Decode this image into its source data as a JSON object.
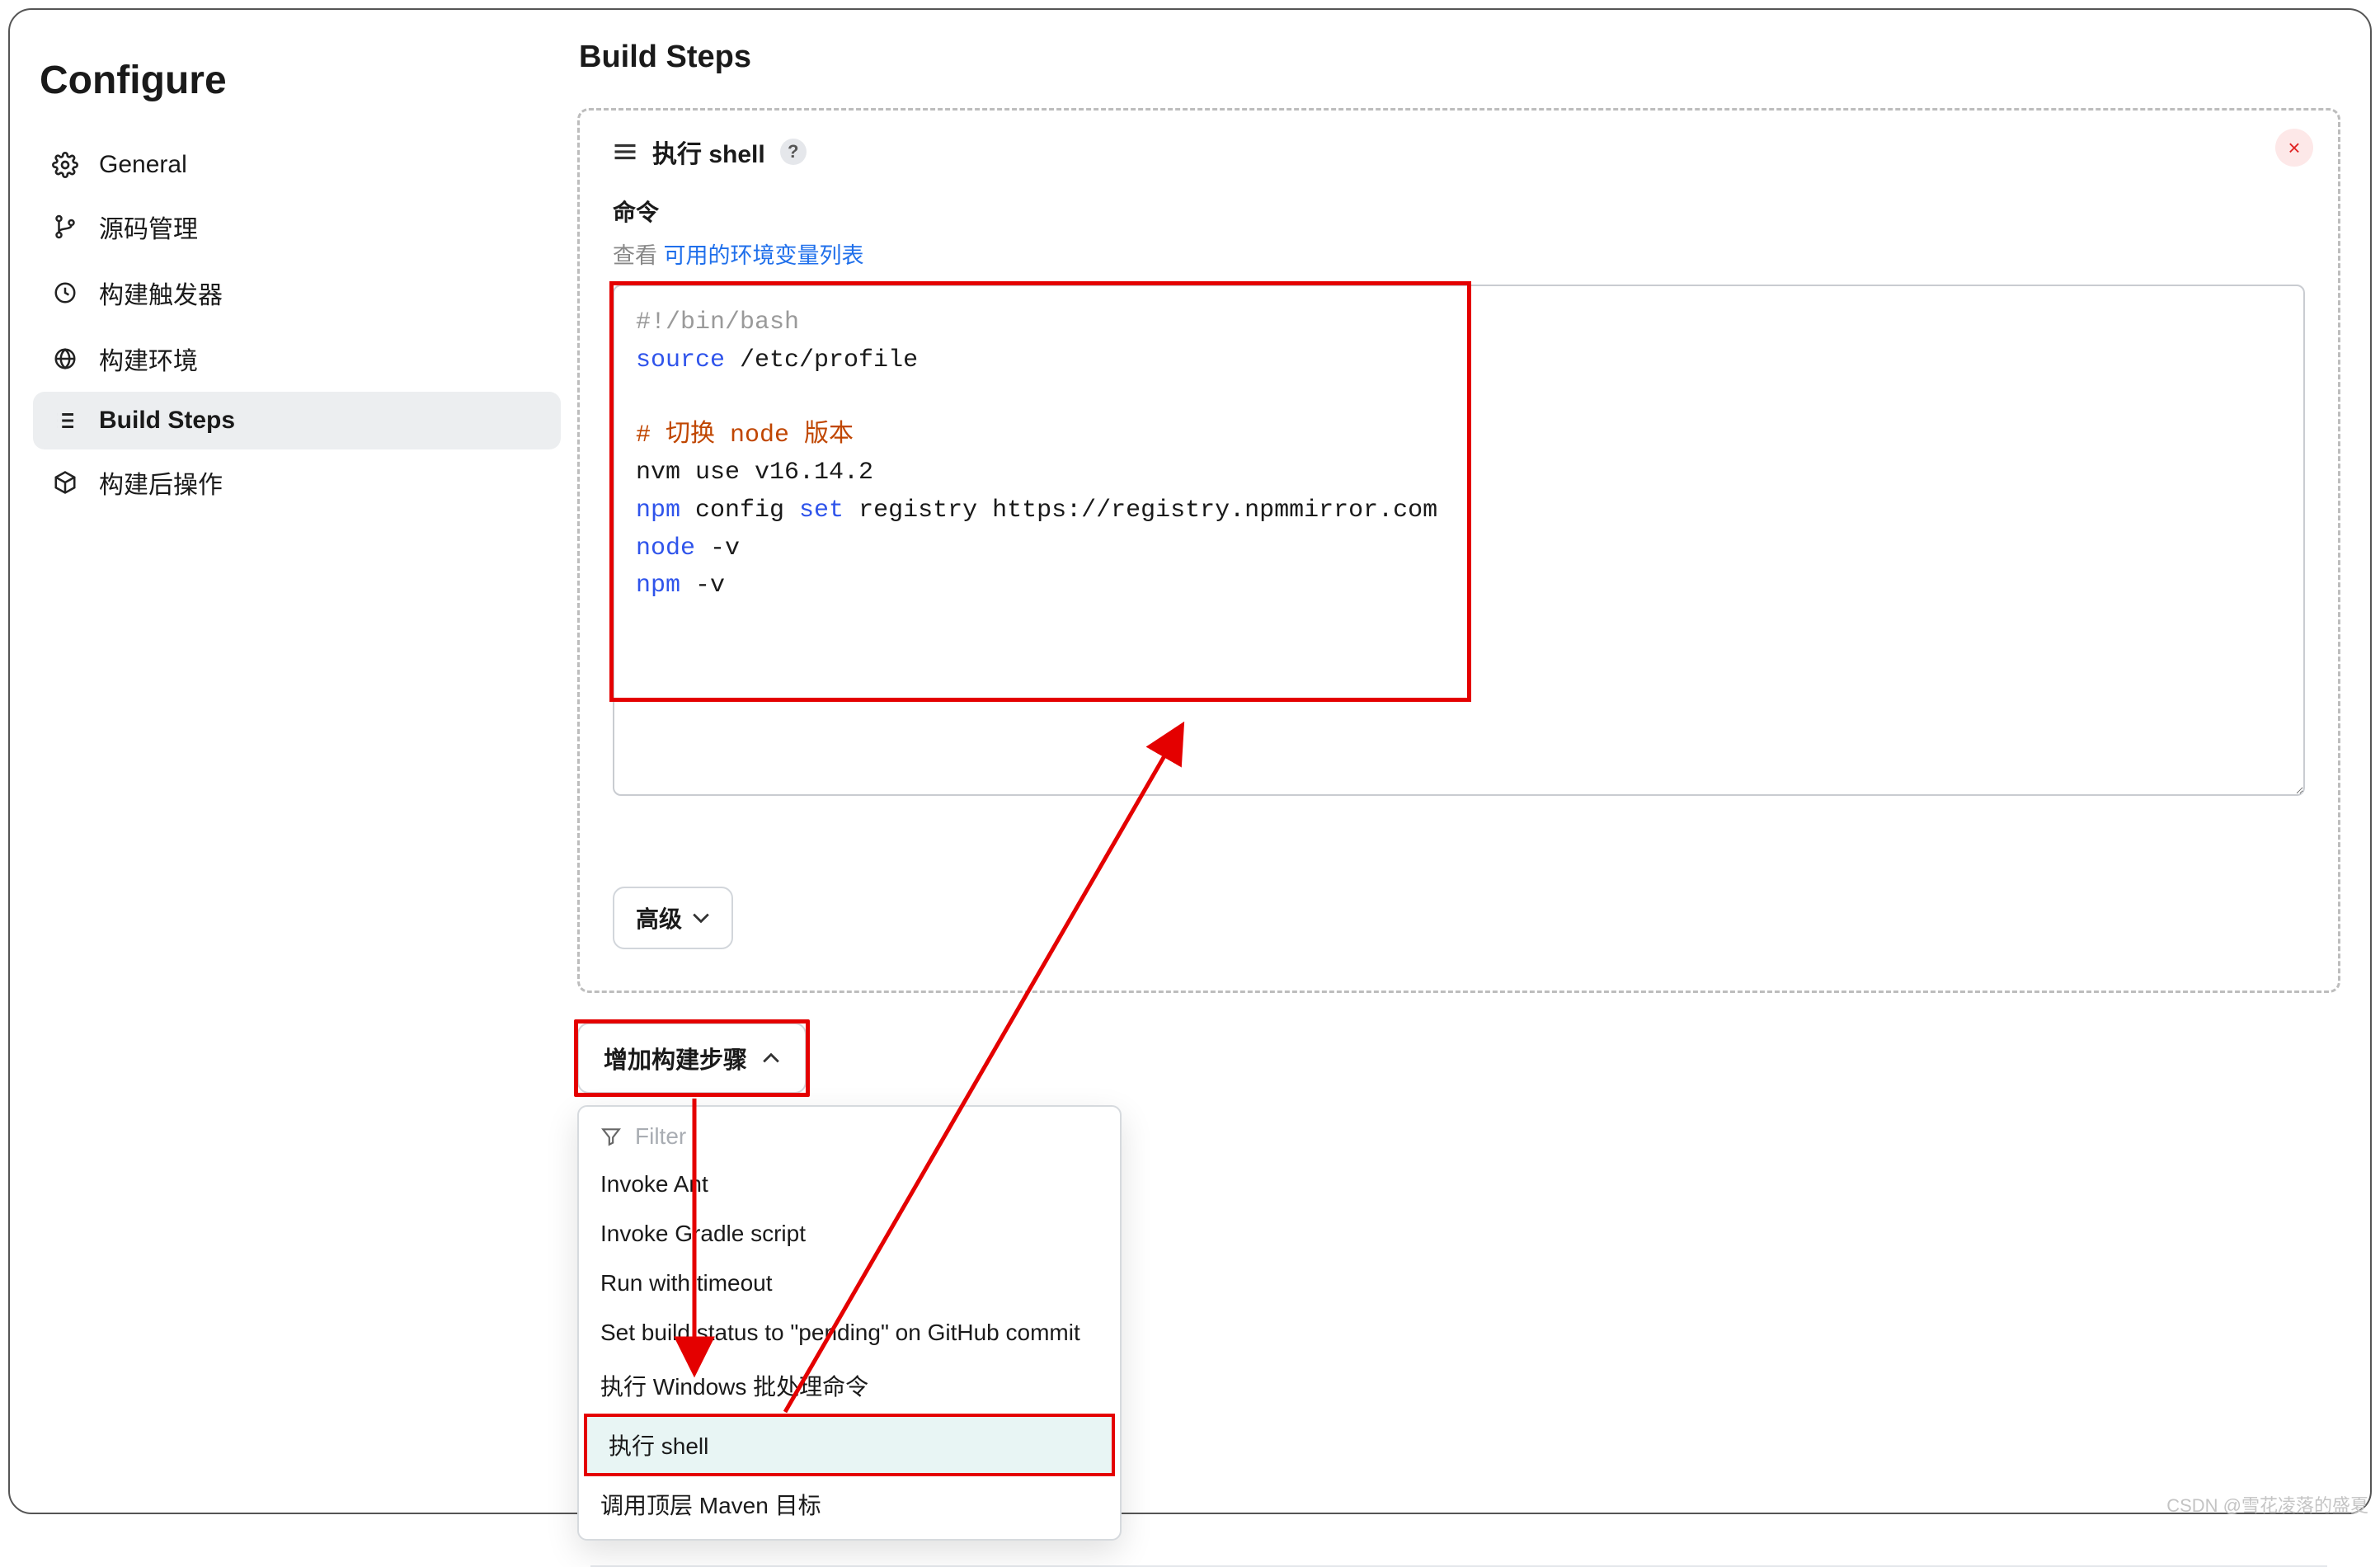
{
  "sidebar": {
    "title": "Configure",
    "items": [
      {
        "label": "General"
      },
      {
        "label": "源码管理"
      },
      {
        "label": "构建触发器"
      },
      {
        "label": "构建环境"
      },
      {
        "label": "Build Steps"
      },
      {
        "label": "构建后操作"
      }
    ]
  },
  "main": {
    "title": "Build Steps"
  },
  "step": {
    "title": "执行 shell",
    "help": "?",
    "close": "×",
    "command_label": "命令",
    "hint_prefix": "查看 ",
    "hint_link": "可用的环境变量列表",
    "code": {
      "line1_shebang": "#!/bin/bash",
      "line2_kw": "source",
      "line2_rest": " /etc/profile",
      "line3_cmt": "# 切换 node 版本",
      "line4": "nvm use v16.14.2",
      "line5_a": "npm",
      "line5_b": " config ",
      "line5_kw": "set",
      "line5_c": " registry https://registry.npmmirror.com",
      "line6_a": "node",
      "line6_b": " -v",
      "line7_a": "npm",
      "line7_b": " -v"
    },
    "advanced": "高级"
  },
  "add": {
    "button": "增加构建步骤",
    "filter_placeholder": "Filter",
    "items": [
      "Invoke Ant",
      "Invoke Gradle script",
      "Run with timeout",
      "Set build status to \"pending\" on GitHub commit",
      "执行 Windows 批处理命令",
      "执行 shell",
      "调用顶层 Maven 目标"
    ]
  },
  "watermark": "CSDN @雪花凌落的盛夏"
}
